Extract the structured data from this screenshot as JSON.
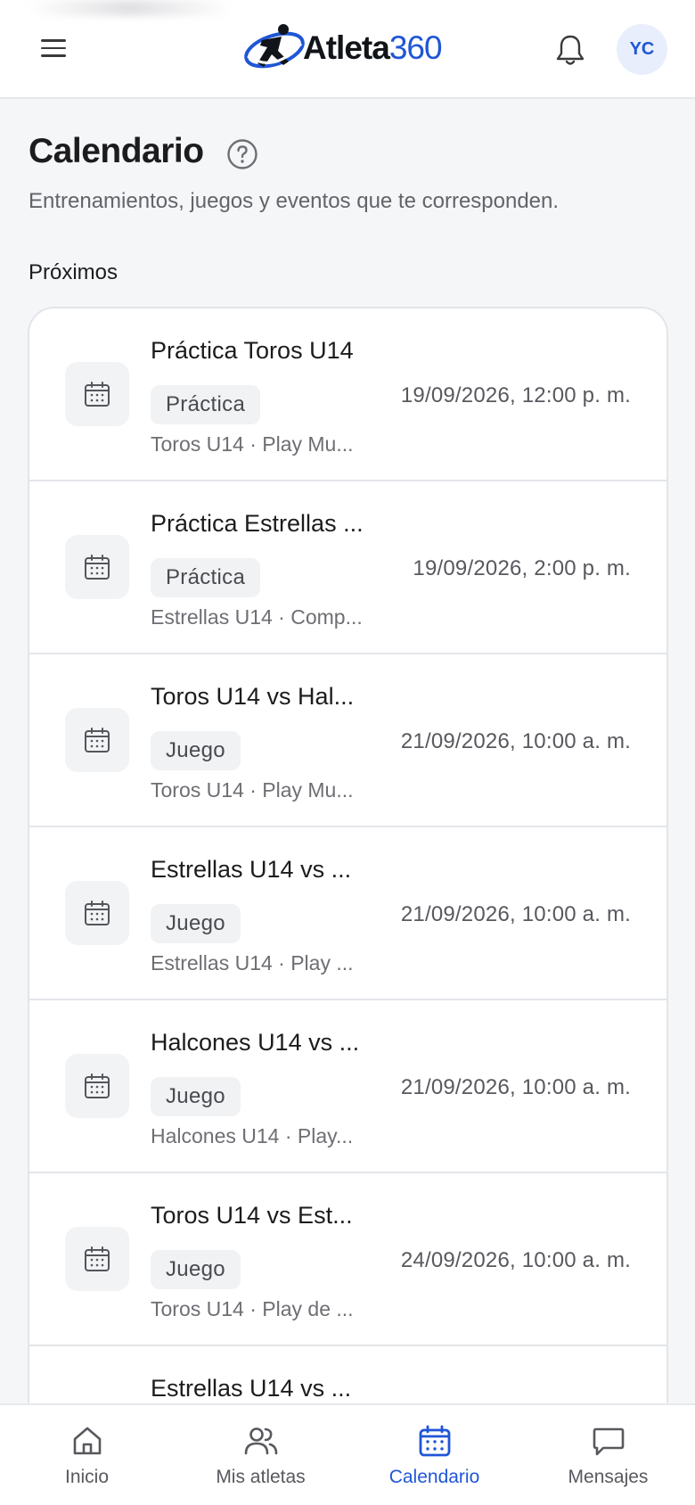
{
  "header": {
    "logo_word1": "Atleta",
    "logo_word2": "360",
    "avatar_initials": "YC",
    "icons": [
      "menu-icon",
      "bell-icon"
    ]
  },
  "page": {
    "title": "Calendario",
    "subtitle": "Entrenamientos, juegos y eventos que te corresponden.",
    "section_label": "Próximos"
  },
  "events": [
    {
      "title": "Práctica Toros U14",
      "type": "Práctica",
      "meta": "Toros U14 · Play Mu...",
      "datetime": "19/09/2026, 12:00 p. m."
    },
    {
      "title": "Práctica Estrellas ...",
      "type": "Práctica",
      "meta": "Estrellas U14 · Comp...",
      "datetime": "19/09/2026, 2:00 p. m."
    },
    {
      "title": "Toros U14 vs Hal...",
      "type": "Juego",
      "meta": "Toros U14 · Play Mu...",
      "datetime": "21/09/2026, 10:00 a. m."
    },
    {
      "title": "Estrellas U14 vs ...",
      "type": "Juego",
      "meta": "Estrellas U14 · Play ...",
      "datetime": "21/09/2026, 10:00 a. m."
    },
    {
      "title": "Halcones U14 vs ...",
      "type": "Juego",
      "meta": "Halcones U14 · Play...",
      "datetime": "21/09/2026, 10:00 a. m."
    },
    {
      "title": "Toros U14 vs Est...",
      "type": "Juego",
      "meta": "Toros U14 · Play de ...",
      "datetime": "24/09/2026, 10:00 a. m."
    },
    {
      "title": "Estrellas U14 vs ...",
      "type": "",
      "meta": "",
      "datetime": ""
    }
  ],
  "bottom_nav": {
    "active": "calendario",
    "items": [
      {
        "id": "inicio",
        "label": "Inicio",
        "icon": "home-icon"
      },
      {
        "id": "mis-atletas",
        "label": "Mis atletas",
        "icon": "users-icon"
      },
      {
        "id": "calendario",
        "label": "Calendario",
        "icon": "calendar-icon"
      },
      {
        "id": "mensajes",
        "label": "Mensajes",
        "icon": "message-icon"
      }
    ]
  },
  "colors": {
    "accent": "#1f56d6",
    "background": "#f5f6f8",
    "card": "#ffffff",
    "border": "#e3e5e9"
  }
}
